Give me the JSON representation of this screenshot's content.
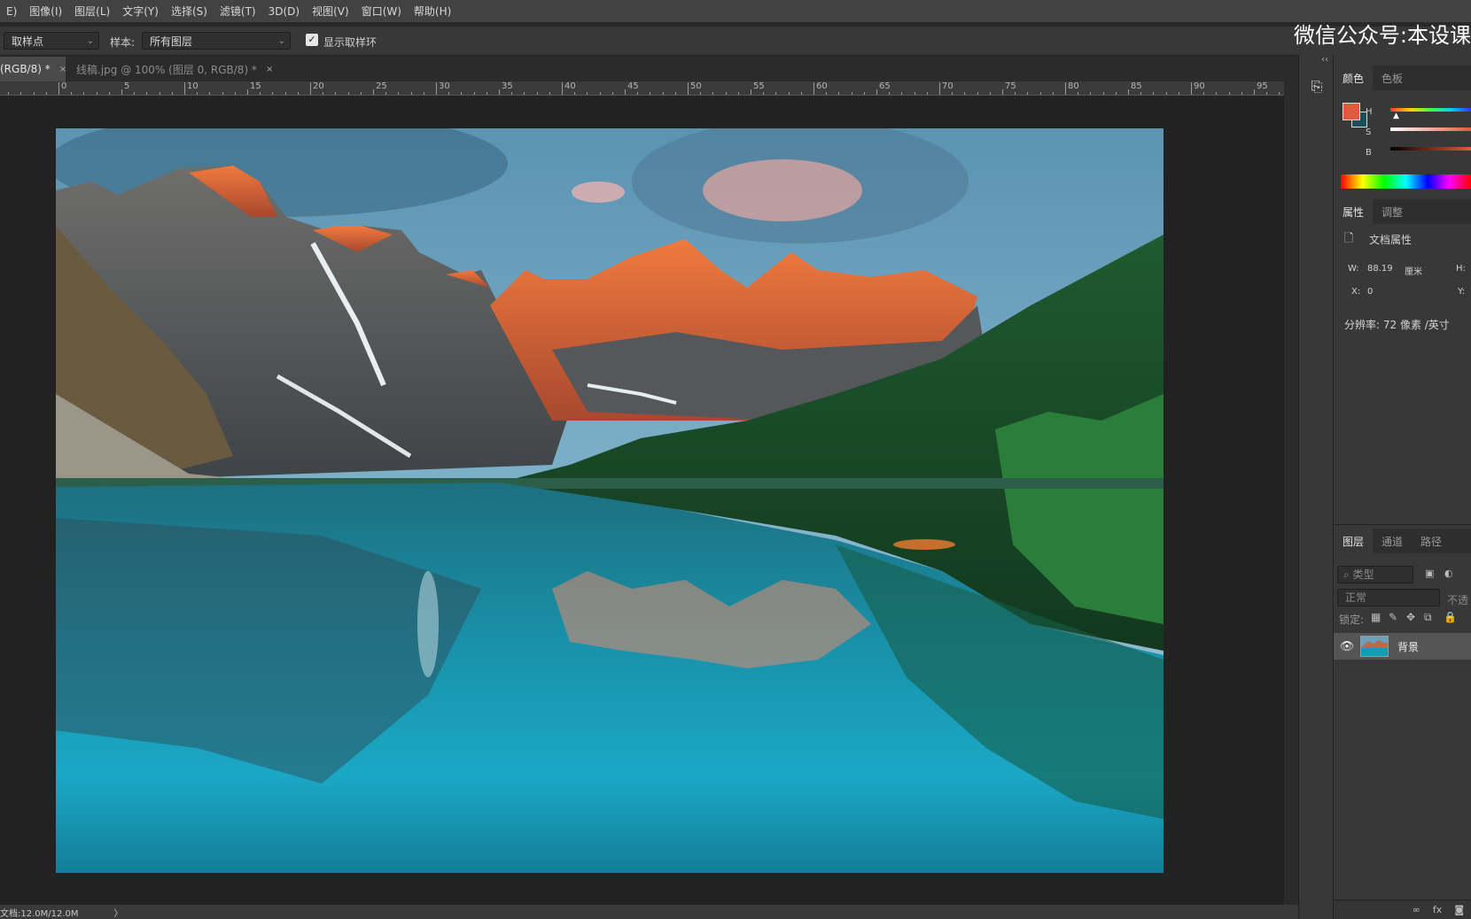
{
  "menu": [
    "E)",
    "图像(I)",
    "图层(L)",
    "文字(Y)",
    "选择(S)",
    "滤镜(T)",
    "3D(D)",
    "视图(V)",
    "窗口(W)",
    "帮助(H)"
  ],
  "watermark": "微信公众号:本设课",
  "options": {
    "sample_size": "取样点",
    "sample_label": "样本:",
    "sample_value": "所有图层",
    "show_ring_label": "显示取样环"
  },
  "tabs": [
    {
      "label": "(RGB/8) *",
      "close": "×"
    },
    {
      "label": "线稿.jpg @ 100% (图层 0, RGB/8) *",
      "close": "×"
    }
  ],
  "ruler_numbers": [
    "0",
    "5",
    "10",
    "15",
    "20",
    "25",
    "30",
    "35",
    "40",
    "45",
    "50",
    "55",
    "60",
    "65",
    "70",
    "75",
    "80",
    "85",
    "90",
    "95"
  ],
  "status": {
    "doc": "文档:12.0M/12.0M",
    "arrow": "〉"
  },
  "color_panel": {
    "tabs": [
      "颜色",
      "色板"
    ],
    "fg_color": "#e05a3c",
    "bg_color": "#1d4f5a",
    "labels": {
      "h": "H",
      "s": "S",
      "b": "B"
    }
  },
  "properties_panel": {
    "tabs": [
      "属性",
      "调整"
    ],
    "doc_props": "文档属性",
    "w_label": "W:",
    "w_value": "88.19",
    "w_unit": "厘米",
    "h_label": "H:",
    "x_label": "X:",
    "x_value": "0",
    "y_label": "Y:",
    "resolution": "分辨率: 72 像素 /英寸"
  },
  "layers_panel": {
    "tabs": [
      "图层",
      "通道",
      "路径"
    ],
    "filter_placeholder": "类型",
    "blend_mode": "正常",
    "opacity_label": "不透",
    "lock_label": "锁定:",
    "layer_name": "背景",
    "bottom_icons": [
      "link",
      "fx",
      "mask"
    ]
  }
}
